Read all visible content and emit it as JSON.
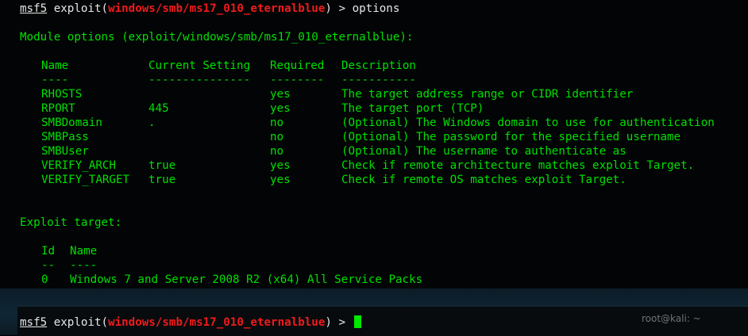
{
  "prompt": {
    "prefix": "msf5",
    "module_word": "exploit",
    "module_path": "windows/smb/ms17_010_eternalblue",
    "arrow": ">"
  },
  "command": "options",
  "module_options_header": "Module options (exploit/windows/smb/ms17_010_eternalblue):",
  "options_table": {
    "headers": [
      "Name",
      "Current Setting",
      "Required",
      "Description"
    ],
    "separators": [
      "----",
      "---------------",
      "--------",
      "-----------"
    ],
    "rows": [
      {
        "name": "RHOSTS",
        "setting": "",
        "required": "yes",
        "description": "The target address range or CIDR identifier"
      },
      {
        "name": "RPORT",
        "setting": "445",
        "required": "yes",
        "description": "The target port (TCP)"
      },
      {
        "name": "SMBDomain",
        "setting": ".",
        "required": "no",
        "description": "(Optional) The Windows domain to use for authentication"
      },
      {
        "name": "SMBPass",
        "setting": "",
        "required": "no",
        "description": "(Optional) The password for the specified username"
      },
      {
        "name": "SMBUser",
        "setting": "",
        "required": "no",
        "description": "(Optional) The username to authenticate as"
      },
      {
        "name": "VERIFY_ARCH",
        "setting": "true",
        "required": "yes",
        "description": "Check if remote architecture matches exploit Target."
      },
      {
        "name": "VERIFY_TARGET",
        "setting": "true",
        "required": "yes",
        "description": "Check if remote OS matches exploit Target."
      }
    ]
  },
  "exploit_target_header": "Exploit target:",
  "target_table": {
    "headers": [
      "Id",
      "Name"
    ],
    "separators": [
      "--",
      "----"
    ],
    "rows": [
      {
        "id": "0",
        "name": "Windows 7 and Server 2008 R2 (x64) All Service Packs"
      }
    ]
  },
  "background_window_title": "root@kali: ~",
  "colors": {
    "terminal_green": "#00e000",
    "prompt_white": "#e7e7e7",
    "module_red": "#f01b1b",
    "background": "#020405"
  }
}
